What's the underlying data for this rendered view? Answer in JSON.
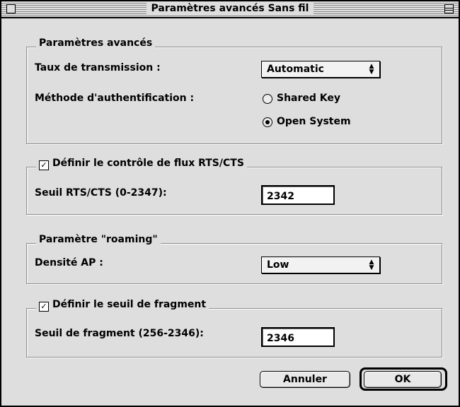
{
  "window": {
    "title": "Paramètres avancés Sans fil"
  },
  "advanced": {
    "legend": "Paramètres avancés",
    "rate_label": "Taux de transmission :",
    "rate_value": "Automatic",
    "auth_label": "Méthode d'authentification :",
    "auth_options": [
      "Shared Key",
      "Open System"
    ],
    "auth_selected": "Open System"
  },
  "rts": {
    "legend": "Définir le contrôle de flux RTS/CTS",
    "checked": true,
    "threshold_label": "Seuil RTS/CTS (0-2347):",
    "threshold_value": "2342"
  },
  "roaming": {
    "legend": "Paramètre \"roaming\"",
    "density_label": "Densité AP :",
    "density_value": "Low"
  },
  "fragment": {
    "legend": "Définir le seuil de fragment",
    "checked": true,
    "threshold_label": "Seuil de fragment (256-2346):",
    "threshold_value": "2346"
  },
  "buttons": {
    "cancel": "Annuler",
    "ok": "OK"
  },
  "icons": {
    "popup_arrows": "up-down-arrows-icon",
    "checkmark": "checkmark-icon"
  }
}
